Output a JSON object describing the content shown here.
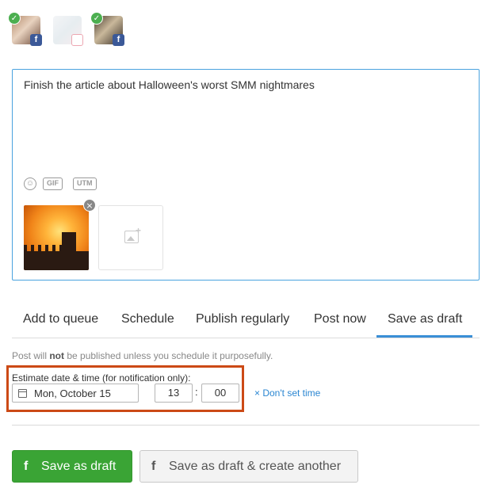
{
  "accounts": [
    {
      "network_icon": "facebook-icon",
      "network_glyph": "f",
      "selected": true
    },
    {
      "network_icon": "instagram-icon",
      "network_glyph": "◎",
      "selected": false
    },
    {
      "network_icon": "facebook-icon",
      "network_glyph": "f",
      "selected": true
    }
  ],
  "glyphs": {
    "check": "✓",
    "remove": "×",
    "emoji": "☺",
    "plus": "+"
  },
  "composer": {
    "text": "Finish the article about Halloween's worst SMM nightmares",
    "tools": {
      "gif": "GIF",
      "utm": "UTM"
    }
  },
  "tabs": {
    "items": [
      "Add to queue",
      "Schedule",
      "Publish regularly",
      "Post now",
      "Save as draft"
    ],
    "active": "Save as draft"
  },
  "note": {
    "before": "Post will ",
    "bold": "not",
    "after": " be published unless you schedule it purposefully."
  },
  "estimate": {
    "label": "Estimate date & time (for notification only):",
    "date": "Mon, October 15",
    "hour": "13",
    "minute": "00",
    "separator": ":",
    "dont_set": "× Don't set time"
  },
  "buttons": {
    "primary": {
      "icon": "f",
      "label": "Save as draft"
    },
    "secondary": {
      "icon": "f",
      "label": "Save as draft & create another"
    }
  },
  "colors": {
    "accent": "#3a8fd6",
    "primary_button": "#3aa435",
    "highlight_box": "#cc4a16",
    "check": "#4caf50",
    "facebook": "#3b5998"
  }
}
